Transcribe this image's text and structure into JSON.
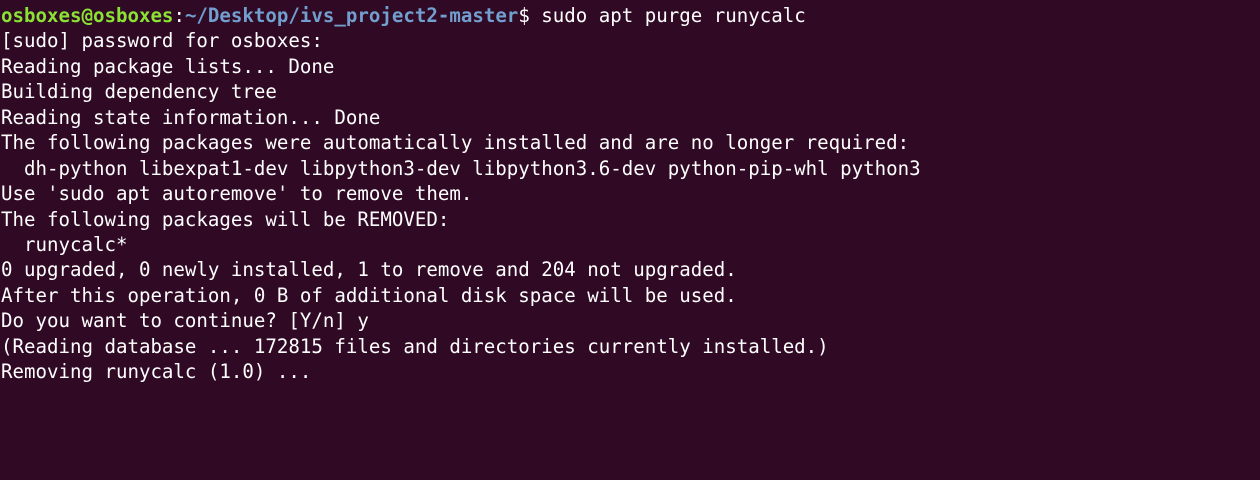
{
  "terminal": {
    "colors": {
      "background": "#300a24",
      "foreground": "#ffffff",
      "prompt_user": "#8ae234",
      "prompt_path": "#729fcf"
    },
    "prompt": {
      "user_host": "osboxes@osboxes",
      "separator": ":",
      "path": "~/Desktop/ivs_project2-master",
      "symbol": "$",
      "command": " sudo apt purge runycalc"
    },
    "output_lines": [
      "[sudo] password for osboxes:",
      "Reading package lists... Done",
      "Building dependency tree",
      "Reading state information... Done",
      "The following packages were automatically installed and are no longer required:",
      "  dh-python libexpat1-dev libpython3-dev libpython3.6-dev python-pip-whl python3",
      "Use 'sudo apt autoremove' to remove them.",
      "The following packages will be REMOVED:",
      "  runycalc*",
      "0 upgraded, 0 newly installed, 1 to remove and 204 not upgraded.",
      "After this operation, 0 B of additional disk space will be used.",
      "Do you want to continue? [Y/n] y",
      "(Reading database ... 172815 files and directories currently installed.)",
      "Removing runycalc (1.0) ..."
    ]
  }
}
